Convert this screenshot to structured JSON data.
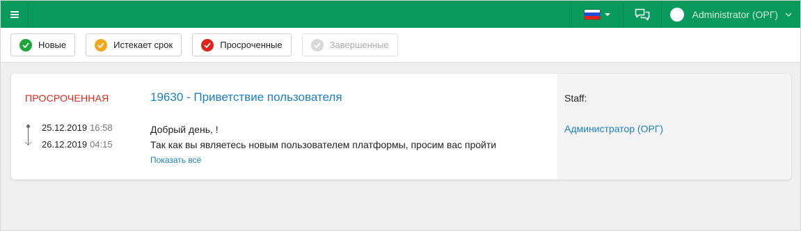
{
  "topbar": {
    "menu_icon": "hamburger-icon",
    "language_flag": [
      "#ffffff",
      "#1f4bd8",
      "#e0201c"
    ],
    "chat_icon": "chat-bubbles-icon",
    "user_name": "Administrator (ОРГ)"
  },
  "filters": [
    {
      "label": "Новые",
      "color": "#1ea63b"
    },
    {
      "label": "Истекает срок",
      "color": "#f0a81c"
    },
    {
      "label": "Просроченные",
      "color": "#e3231b"
    },
    {
      "label": "Завершенные",
      "color": "#d8d8d8",
      "disabled": true
    }
  ],
  "task": {
    "status": "ПРОСРОЧЕННАЯ",
    "title": "19630 - Приветствие пользователя",
    "start_date": "25.12.2019",
    "start_time": "16:58",
    "end_date": "26.12.2019",
    "end_time": "04:15",
    "message_line1": "Добрый день,  !",
    "message_line2": "Так как вы являетесь новым пользователем платформы, просим вас пройти",
    "show_all": "Показать всё",
    "staff_label": "Staff:",
    "staff_name": "Администратор (ОРГ)"
  }
}
